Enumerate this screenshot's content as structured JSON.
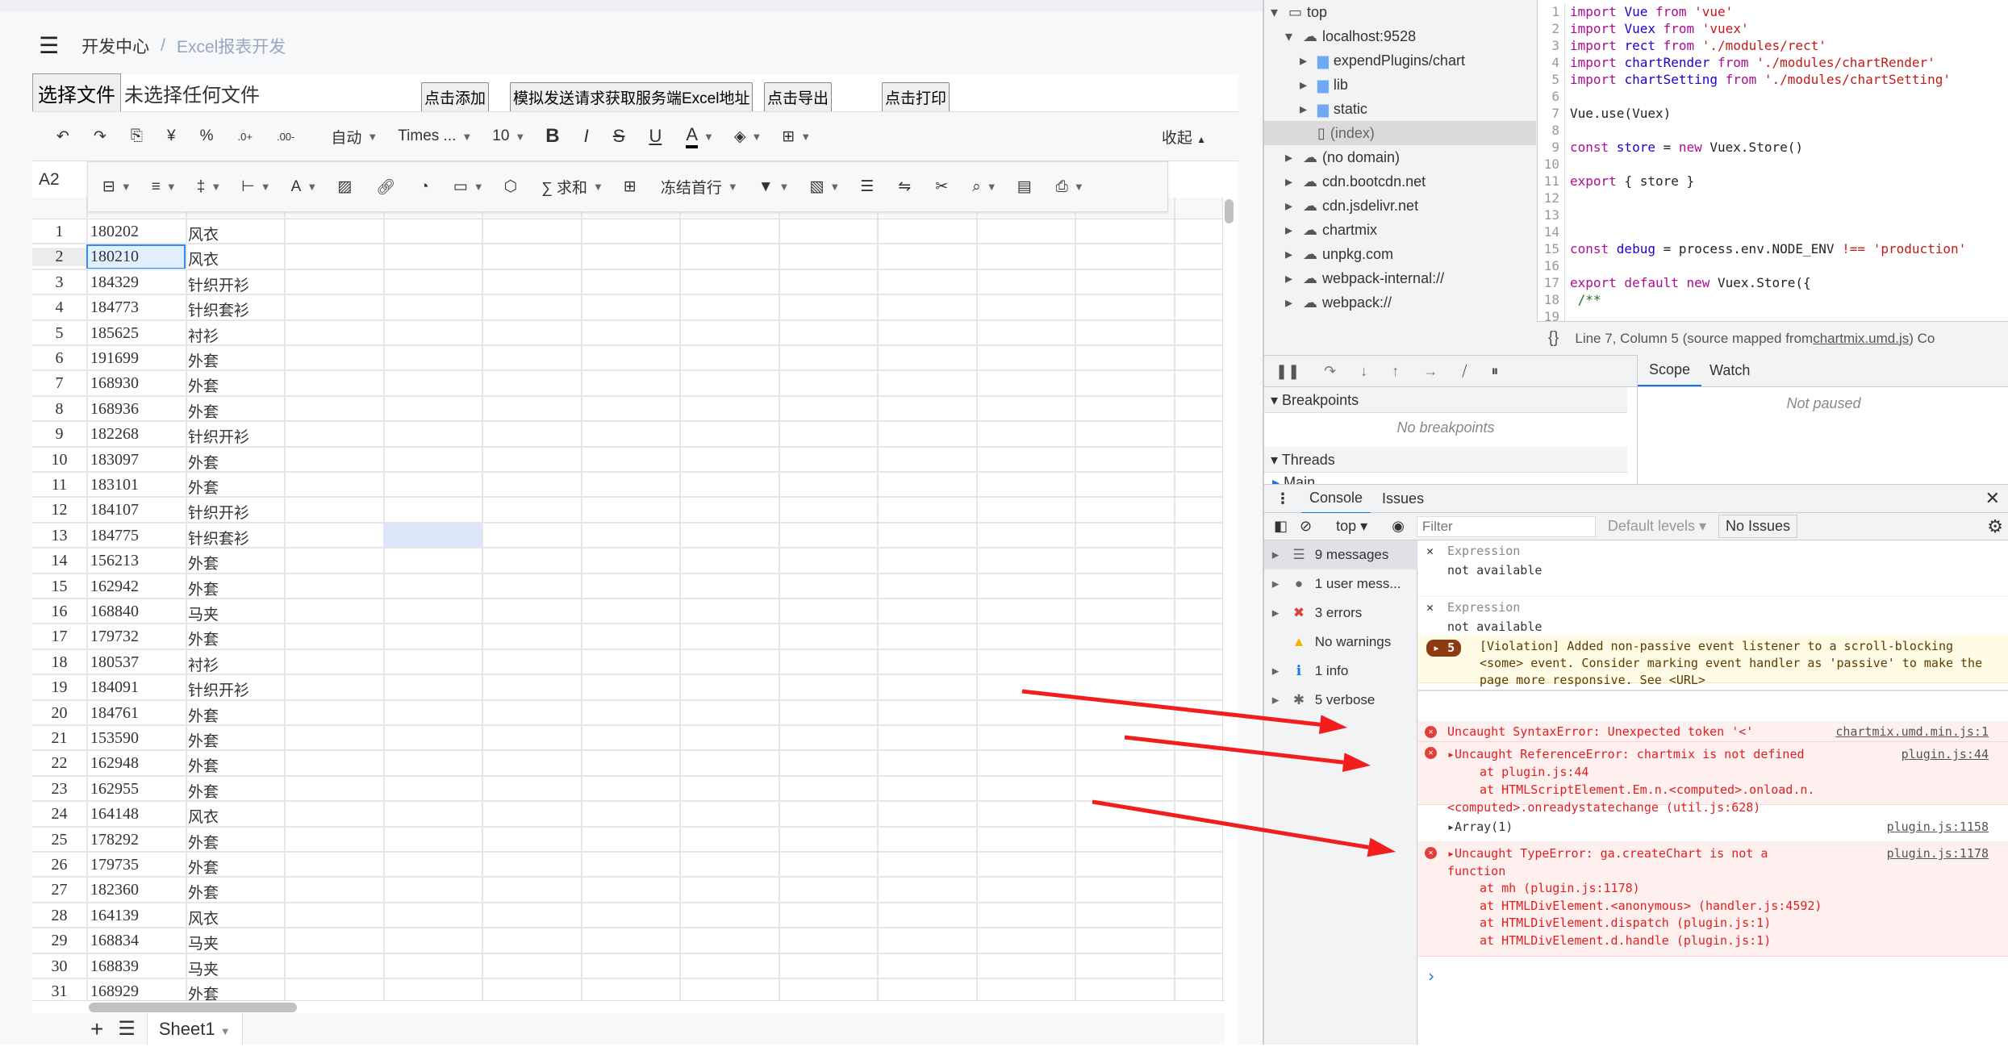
{
  "breadcrumb": {
    "home": "开发中心",
    "separator": "/",
    "current": "Excel报表开发"
  },
  "file": {
    "choose_label": "选择文件",
    "status": "未选择任何文件"
  },
  "buttons": {
    "add": "点击添加",
    "fetch": "模拟发送请求获取服务端Excel地址",
    "export": "点击导出",
    "print": "点击打印"
  },
  "toolbar1": {
    "undo": "↶",
    "redo": "↷",
    "currency": "¥",
    "percent": "%",
    "dec_plus": ".0+",
    "dec_minus": ".00-",
    "format": "自动",
    "font": "Times ...",
    "size": "10",
    "bold": "B",
    "italic": "I",
    "strike": "S",
    "underline": "U",
    "font_color": "A",
    "collapse": "收起"
  },
  "toolbar2": {
    "sum": "求和",
    "freeze": "冻结首行"
  },
  "cell_ref": "A2",
  "rows": [
    [
      "1",
      "180202",
      "风衣"
    ],
    [
      "2",
      "180210",
      "风衣"
    ],
    [
      "3",
      "184329",
      "针织开衫"
    ],
    [
      "4",
      "184773",
      "针织套衫"
    ],
    [
      "5",
      "185625",
      "衬衫"
    ],
    [
      "6",
      "191699",
      "外套"
    ],
    [
      "7",
      "168930",
      "外套"
    ],
    [
      "8",
      "168936",
      "外套"
    ],
    [
      "9",
      "182268",
      "针织开衫"
    ],
    [
      "10",
      "183097",
      "外套"
    ],
    [
      "11",
      "183101",
      "外套"
    ],
    [
      "12",
      "184107",
      "针织开衫"
    ],
    [
      "13",
      "184775",
      "针织套衫"
    ],
    [
      "14",
      "156213",
      "外套"
    ],
    [
      "15",
      "162942",
      "外套"
    ],
    [
      "16",
      "168840",
      "马夹"
    ],
    [
      "17",
      "179732",
      "外套"
    ],
    [
      "18",
      "180537",
      "衬衫"
    ],
    [
      "19",
      "184091",
      "针织开衫"
    ],
    [
      "20",
      "184761",
      "外套"
    ],
    [
      "21",
      "153590",
      "外套"
    ],
    [
      "22",
      "162948",
      "外套"
    ],
    [
      "23",
      "162955",
      "外套"
    ],
    [
      "24",
      "164148",
      "风衣"
    ],
    [
      "25",
      "178292",
      "外套"
    ],
    [
      "26",
      "179735",
      "外套"
    ],
    [
      "27",
      "182360",
      "外套"
    ],
    [
      "28",
      "164139",
      "风衣"
    ],
    [
      "29",
      "168834",
      "马夹"
    ],
    [
      "30",
      "168839",
      "马夹"
    ],
    [
      "31",
      "168929",
      "外套"
    ]
  ],
  "sheet_tab": "Sheet1",
  "devtools": {
    "tree": [
      {
        "label": "top",
        "level": 0,
        "icon": "frame-icon",
        "open": true
      },
      {
        "label": "localhost:9528",
        "level": 1,
        "icon": "cloud-icon",
        "open": true
      },
      {
        "label": "expendPlugins/chart",
        "level": 2,
        "icon": "folder-icon"
      },
      {
        "label": "lib",
        "level": 2,
        "icon": "folder-icon"
      },
      {
        "label": "static",
        "level": 2,
        "icon": "folder-icon"
      },
      {
        "label": "(index)",
        "level": 2,
        "icon": "file-icon",
        "selected": true
      },
      {
        "label": "(no domain)",
        "level": 1,
        "icon": "cloud-icon"
      },
      {
        "label": "cdn.bootcdn.net",
        "level": 1,
        "icon": "cloud-icon"
      },
      {
        "label": "cdn.jsdelivr.net",
        "level": 1,
        "icon": "cloud-icon"
      },
      {
        "label": "chartmix",
        "level": 1,
        "icon": "cloud-icon"
      },
      {
        "label": "unpkg.com",
        "level": 1,
        "icon": "cloud-icon"
      },
      {
        "label": "webpack-internal://",
        "level": 1,
        "icon": "cloud-icon"
      },
      {
        "label": "webpack://",
        "level": 1,
        "icon": "cloud-icon"
      }
    ],
    "code": [
      [
        [
          "kw",
          "import "
        ],
        [
          "vr",
          "Vue "
        ],
        [
          "kw",
          "from "
        ],
        [
          "st",
          "'vue'"
        ]
      ],
      [
        [
          "kw",
          "import "
        ],
        [
          "vr",
          "Vuex "
        ],
        [
          "kw",
          "from "
        ],
        [
          "st",
          "'vuex'"
        ]
      ],
      [
        [
          "kw",
          "import "
        ],
        [
          "vr",
          "rect "
        ],
        [
          "kw",
          "from "
        ],
        [
          "st",
          "'./modules/rect'"
        ]
      ],
      [
        [
          "kw",
          "import "
        ],
        [
          "vr",
          "chartRender "
        ],
        [
          "kw",
          "from "
        ],
        [
          "st",
          "'./modules/chartRender'"
        ]
      ],
      [
        [
          "kw",
          "import "
        ],
        [
          "vr",
          "chartSetting "
        ],
        [
          "kw",
          "from "
        ],
        [
          "st",
          "'./modules/chartSetting'"
        ]
      ],
      [],
      [
        [
          "df",
          "Vue.use(Vuex)"
        ]
      ],
      [],
      [
        [
          "kw",
          "const "
        ],
        [
          "vr",
          "store "
        ],
        [
          "df",
          "= "
        ],
        [
          "kw",
          "new "
        ],
        [
          "df",
          "Vuex.Store()"
        ]
      ],
      [],
      [
        [
          "kw",
          "export "
        ],
        [
          "df",
          "{ store }"
        ]
      ],
      [],
      [],
      [],
      [
        [
          "kw",
          "const "
        ],
        [
          "vr",
          "debug "
        ],
        [
          "df",
          "= process.env.NODE_ENV "
        ],
        [
          "st",
          "!== 'production'"
        ]
      ],
      [],
      [
        [
          "kw",
          "export default new "
        ],
        [
          "df",
          "Vuex.Store({"
        ]
      ],
      [
        [
          "cm",
          "    /**"
        ]
      ],
      []
    ],
    "status": {
      "pos": "Line 7, Column 5",
      "mapped_prefix": "(source mapped from ",
      "mapped_file": "chartmix.umd.js",
      "mapped_suffix": ") Co"
    },
    "breakpoints_label": "Breakpoints",
    "no_breakpoints": "No breakpoints",
    "threads_label": "Threads",
    "thread_main": "Main",
    "scope_tab": "Scope",
    "watch_tab": "Watch",
    "not_paused": "Not paused",
    "console_tab": "Console",
    "issues_tab": "Issues",
    "context": "top",
    "filter_placeholder": "Filter",
    "levels": "Default levels",
    "no_issues": "No Issues",
    "sidebar": [
      {
        "label": "9 messages",
        "icon": "list-icon",
        "color": "#666"
      },
      {
        "label": "1 user mess...",
        "icon": "user-icon",
        "color": "#666"
      },
      {
        "label": "3 errors",
        "icon": "error-icon",
        "color": "#e0403a"
      },
      {
        "label": "No warnings",
        "icon": "warning-icon",
        "color": "#f4b400"
      },
      {
        "label": "1 info",
        "icon": "info-icon",
        "color": "#1a73e8"
      },
      {
        "label": "5 verbose",
        "icon": "bug-icon",
        "color": "#666"
      }
    ],
    "expressions": [
      {
        "label": "Expression",
        "value": "not available"
      },
      {
        "label": "Expression",
        "value": "not available"
      }
    ],
    "violation": {
      "count": "5",
      "text": "[Violation] Added non-passive event listener to a scroll-blocking <some> event. Consider marking event handler as 'passive' to make the page more responsive. See <URL>"
    },
    "errors": {
      "syntax": {
        "text": "Uncaught SyntaxError: Unexpected token '<'",
        "src": "chartmix.umd.min.js:1"
      },
      "reference": {
        "text": "Uncaught ReferenceError: chartmix is not defined",
        "src": "plugin.js:44",
        "stack": [
          "at plugin.js:44",
          "at HTMLScriptElement.Em.n.<computed>.onload.n.<computed>.onreadystatechange (util.js:628)"
        ]
      },
      "array": {
        "text": "Array(1)",
        "src": "plugin.js:1158"
      },
      "type": {
        "text": "Uncaught TypeError: ga.createChart is not a function",
        "src": "plugin.js:1178",
        "stack": [
          "at mh (plugin.js:1178)",
          "at HTMLDivElement.<anonymous> (handler.js:4592)",
          "at HTMLDivElement.dispatch (plugin.js:1)",
          "at HTMLDivElement.d.handle (plugin.js:1)"
        ]
      }
    },
    "prompt": "›"
  },
  "colors": {
    "accent": "#2f8cf0",
    "error": "#e01e1e",
    "annotation_arrow": "#f21d1d"
  }
}
